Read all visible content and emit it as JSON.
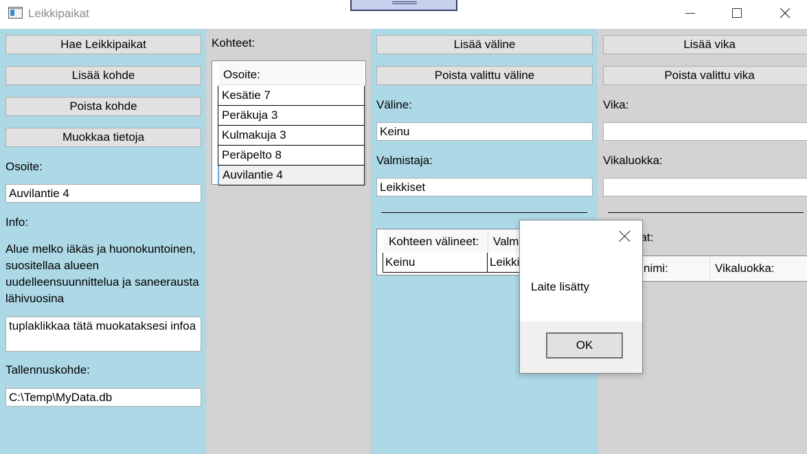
{
  "window": {
    "title": "Leikkipaikat",
    "icons": [
      "app-icon",
      "minimize-icon",
      "maximize-icon",
      "close-icon"
    ]
  },
  "left_panel": {
    "buttons": {
      "fetch": "Hae Leikkipaikat",
      "add_site": "Lisää kohde",
      "remove_site": "Poista kohde",
      "edit": "Muokkaa tietoja"
    },
    "address_label": "Osoite:",
    "address_value": "Auvilantie 4",
    "info_label": "Info:",
    "info_text": "Alue melko iäkäs ja huonokuntoinen, suositellaa alueen uudelleensuunnittelua ja saneerausta lähivuosina",
    "info_edit_value": "tuplaklikkaa tätä muokataksesi infoa",
    "storage_label": "Tallennuskohde:",
    "storage_value": "C:\\Temp\\MyData.db"
  },
  "sites_panel": {
    "label": "Kohteet:",
    "header": "Osoite:",
    "items": [
      "Kesätie 7",
      "Peräkuja 3",
      "Kulmakuja 3",
      "Peräpelto 8",
      "Auvilantie 4"
    ],
    "selected": "Auvilantie 4"
  },
  "equipment_panel": {
    "add_button": "Lisää väline",
    "remove_button": "Poista valittu väline",
    "name_label": "Väline:",
    "name_value": "Keinu",
    "maker_label": "Valmistaja:",
    "maker_value": "Leikkiset",
    "grid": {
      "headers": [
        "Kohteen välineet:",
        "Valm"
      ],
      "rows": [
        [
          "Keinu",
          "Leikki"
        ]
      ]
    }
  },
  "faults_panel": {
    "add_button": "Lisää vika",
    "remove_button": "Poista valittu vika",
    "fault_label": "Vika:",
    "fault_value": "",
    "class_label": "Vikaluokka:",
    "class_value": "",
    "list_label": "n viat:",
    "grid": {
      "headers": [
        "nimi:",
        "Vikaluokka:"
      ]
    }
  },
  "dialog": {
    "message": "Laite lisätty",
    "ok_label": "OK"
  }
}
